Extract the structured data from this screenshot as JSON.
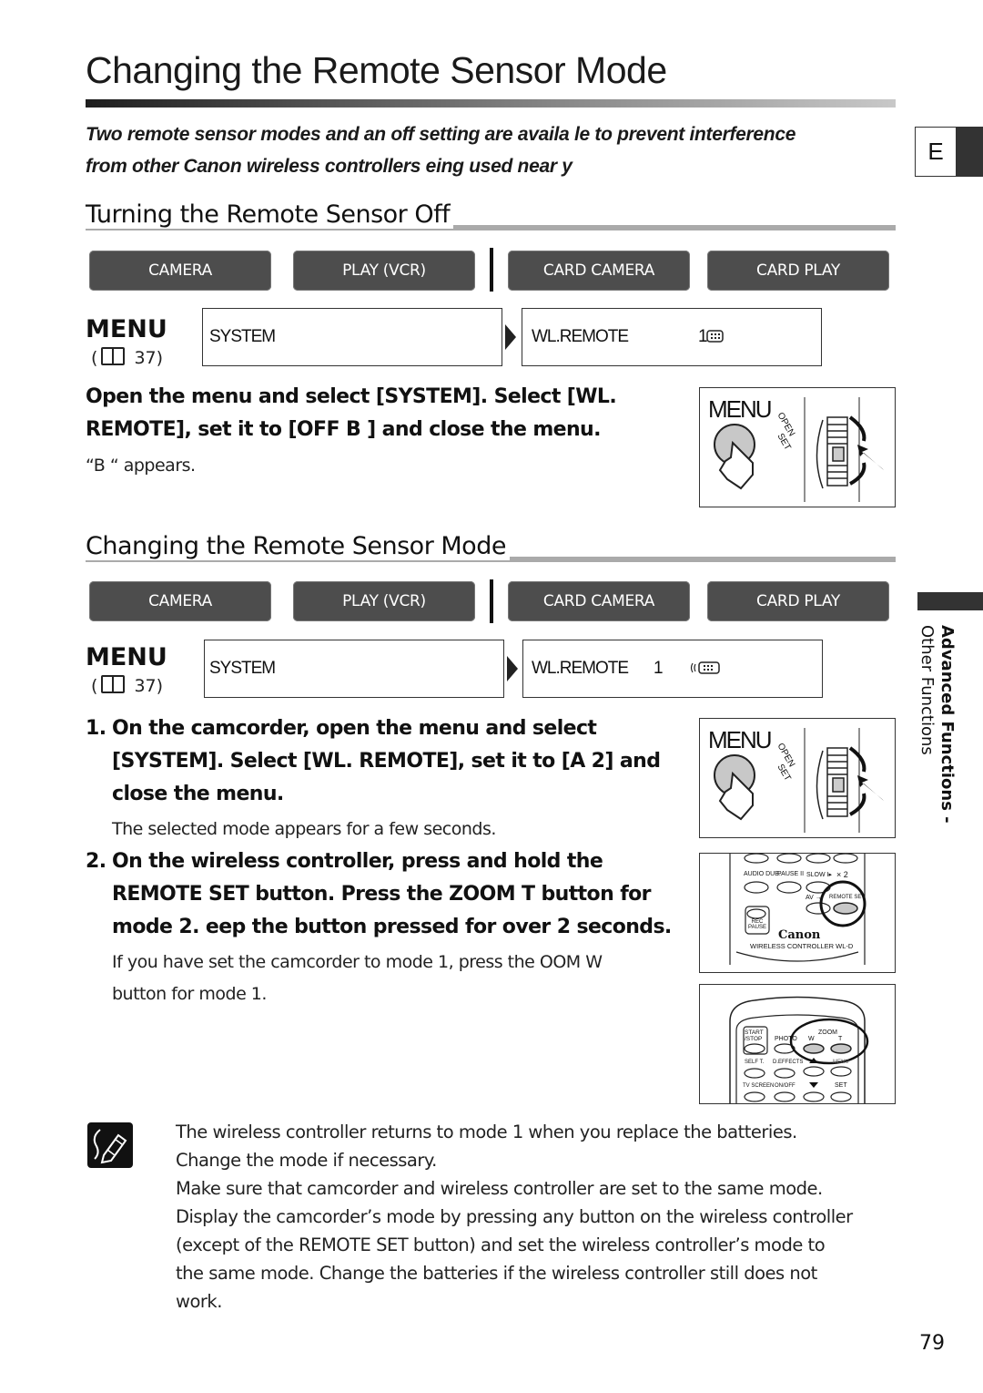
{
  "page": {
    "title": "Changing the Remote Sensor Mode",
    "intro_line1": "Two remote sensor modes and an off setting are availa  le to prevent interference",
    "intro_line2": "from other Canon wireless controllers   eing used near  y",
    "language_tab": "E",
    "page_number": "79"
  },
  "sidebar": {
    "section_bold": "Advanced Functions -",
    "section": "Other Functions"
  },
  "section_off": {
    "heading": "Turning the Remote Sensor Off",
    "modes": [
      "CAMERA",
      "PLAY (VCR)",
      "CARD CAMERA",
      "CARD PLAY"
    ],
    "menu_label": "MENU",
    "menu_ref_page": "37",
    "menu_ref_open": "(",
    "menu_ref_close": ")",
    "lcd_left": "SYSTEM",
    "lcd_right_label": "WL.REMOTE",
    "lcd_right_value": "1",
    "instruction_line1": "Open the menu and select [SYSTEM]. Select [WL.",
    "instruction_line2": "REMOTE], set it to [OFF B    ] and close the menu.",
    "note": "“B    “ appears.",
    "illustration": {
      "menu_label": "MENU",
      "open_label": "OPEN",
      "set_label": "SET"
    }
  },
  "section_change": {
    "heading": "Changing the Remote Sensor Mode",
    "modes": [
      "CAMERA",
      "PLAY (VCR)",
      "CARD CAMERA",
      "CARD PLAY"
    ],
    "menu_label": "MENU",
    "menu_ref_page": "37",
    "menu_ref_open": "(",
    "menu_ref_close": ")",
    "lcd_left": "SYSTEM",
    "lcd_right_label": "WL.REMOTE",
    "lcd_right_value": "1",
    "steps": [
      {
        "number": "1.",
        "lines": [
          "On the camcorder, open the menu and select",
          "[SYSTEM]. Select [WL. REMOTE], set it to [A     2] and",
          "close the menu."
        ],
        "note_lines": [
          "The selected mode appears for a few seconds."
        ]
      },
      {
        "number": "2.",
        "lines": [
          "On the wireless controller, press and hold the",
          "REMOTE SET button. Press the ZOOM T button for",
          "mode 2.    eep the button pressed for over 2 seconds."
        ],
        "note_lines": [
          "If you have set the camcorder to mode 1, press the    OOM W",
          "button for mode 1."
        ]
      }
    ],
    "illustration_menu": {
      "menu_label": "MENU",
      "open_label": "OPEN",
      "set_label": "SET"
    },
    "illustration_remote_top": {
      "labels": [
        "AUDIO DUB.",
        "PAUSE II",
        "SLOW I▸",
        "× 2",
        "AV →",
        "REMOTE SET",
        "REC PAUSE"
      ],
      "brand": "Canon",
      "model": "WIRELESS CONTROLLER WL-D"
    },
    "illustration_remote_bottom": {
      "labels": [
        "START /STOP",
        "PHOTO",
        "ZOOM",
        "W",
        "T",
        "SELF T.",
        "D.EFFECTS",
        "MENU",
        "TV SCREEN",
        "ON/OFF",
        "SET"
      ]
    }
  },
  "notes": [
    "The wireless controller returns to mode 1 when you replace the batteries.",
    "Change the mode if necessary.",
    "Make sure that camcorder and wireless controller are set to the same mode.",
    "Display the camcorder’s mode by pressing any button on the wireless controller",
    "(except of the REMOTE SET button) and set the wireless controller’s mode to",
    "the same mode. Change the batteries if the wireless controller still does not",
    "work."
  ]
}
